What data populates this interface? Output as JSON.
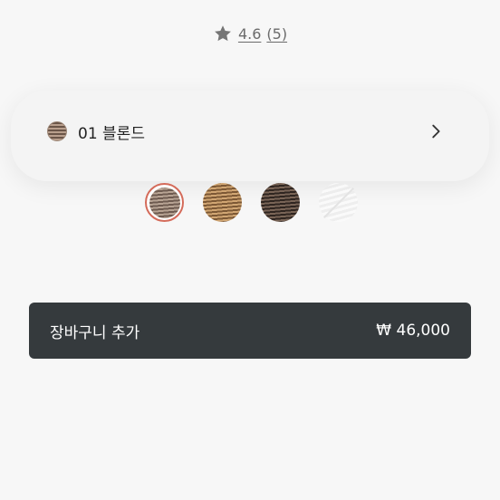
{
  "rating": {
    "icon": "star-icon",
    "score": "4.6",
    "count": "(5)"
  },
  "option": {
    "selected_label": "01 블론드",
    "chevron_icon": "chevron-right-icon"
  },
  "swatches": [
    {
      "name": "swatch-01",
      "state": "selected"
    },
    {
      "name": "swatch-02",
      "state": "available"
    },
    {
      "name": "swatch-03",
      "state": "available"
    },
    {
      "name": "swatch-04",
      "state": "unavailable"
    }
  ],
  "cart": {
    "label": "장바구니 추가",
    "price": "₩ 46,000"
  },
  "colors": {
    "background": "#f7f7f7",
    "button": "#353a3d",
    "selected_ring": "#d46b5a",
    "rating_text": "#6b6b6b"
  }
}
